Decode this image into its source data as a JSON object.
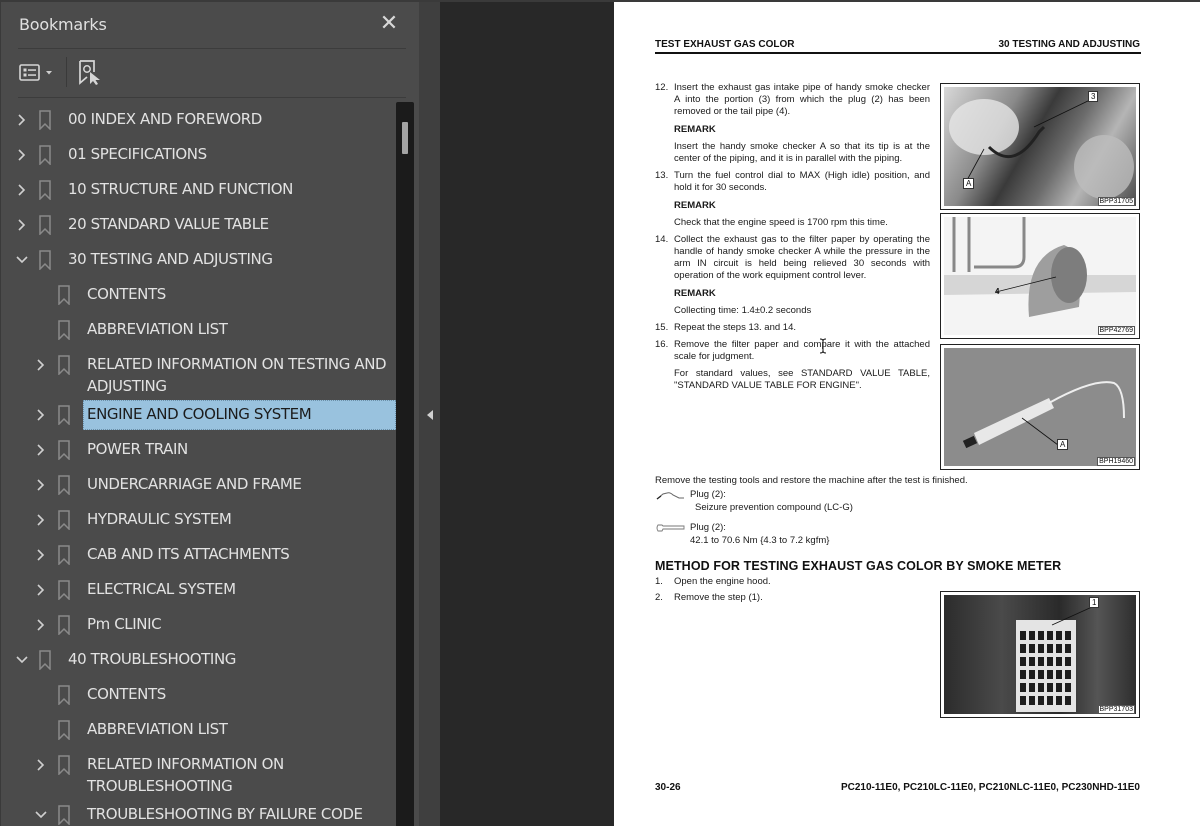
{
  "sidebar": {
    "title": "Bookmarks",
    "close_icon": "close-icon",
    "toolbar": {
      "options_icon": "bookmark-options-icon",
      "find_icon": "find-current-bookmark-icon"
    },
    "items": [
      {
        "label": "00 INDEX AND FOREWORD",
        "level": 0,
        "state": "collapsed"
      },
      {
        "label": "01 SPECIFICATIONS",
        "level": 0,
        "state": "collapsed"
      },
      {
        "label": "10 STRUCTURE AND FUNCTION",
        "level": 0,
        "state": "collapsed"
      },
      {
        "label": "20 STANDARD VALUE TABLE",
        "level": 0,
        "state": "collapsed"
      },
      {
        "label": "30 TESTING AND ADJUSTING",
        "level": 0,
        "state": "expanded"
      },
      {
        "label": "CONTENTS",
        "level": 1,
        "state": "leaf"
      },
      {
        "label": "ABBREVIATION LIST",
        "level": 1,
        "state": "leaf"
      },
      {
        "label": "RELATED INFORMATION ON TESTING AND ADJUSTING",
        "level": 1,
        "state": "collapsed"
      },
      {
        "label": "ENGINE AND COOLING SYSTEM",
        "level": 1,
        "state": "collapsed",
        "selected": true
      },
      {
        "label": "POWER TRAIN",
        "level": 1,
        "state": "collapsed"
      },
      {
        "label": "UNDERCARRIAGE AND FRAME",
        "level": 1,
        "state": "collapsed"
      },
      {
        "label": "HYDRAULIC SYSTEM",
        "level": 1,
        "state": "collapsed"
      },
      {
        "label": "CAB AND ITS ATTACHMENTS",
        "level": 1,
        "state": "collapsed"
      },
      {
        "label": "ELECTRICAL SYSTEM",
        "level": 1,
        "state": "collapsed"
      },
      {
        "label": "Pm CLINIC",
        "level": 1,
        "state": "collapsed"
      },
      {
        "label": "40 TROUBLESHOOTING",
        "level": 0,
        "state": "expanded"
      },
      {
        "label": "CONTENTS",
        "level": 1,
        "state": "leaf"
      },
      {
        "label": "ABBREVIATION LIST",
        "level": 1,
        "state": "leaf"
      },
      {
        "label": "RELATED INFORMATION ON TROUBLESHOOTING",
        "level": 1,
        "state": "collapsed"
      },
      {
        "label": "TROUBLESHOOTING BY FAILURE CODE",
        "level": 1,
        "state": "expanded"
      }
    ],
    "selection_color": "#99c2de"
  },
  "document": {
    "header_left": "TEST EXHAUST GAS COLOR",
    "header_right": "30 TESTING AND ADJUSTING",
    "steps": [
      {
        "num": "12.",
        "text": "Insert the exhaust gas intake pipe of handy smoke checker A into the portion (3) from which the plug (2) has been removed or the tail pipe (4).",
        "remark_label": "REMARK",
        "remark": "Insert the handy smoke checker A so that its tip is at the center of the piping, and it is in parallel with the piping."
      },
      {
        "num": "13.",
        "text": "Turn the fuel control dial to MAX (High idle) position, and hold it for 30 seconds.",
        "remark_label": "REMARK",
        "remark": "Check that the engine speed is 1700 rpm this time."
      },
      {
        "num": "14.",
        "text": "Collect the exhaust gas to the filter paper by operating the handle of handy smoke checker A while the pressure in the arm IN circuit is held being relieved 30 seconds with operation of the work equipment control lever.",
        "remark_label": "REMARK",
        "remark": "Collecting time: 1.4±0.2 seconds"
      },
      {
        "num": "15.",
        "text": "Repeat the steps 13. and 14."
      },
      {
        "num": "16.",
        "text": "Remove the filter paper and compare it with the attached scale for judgment.",
        "note": "For standard values, see STANDARD VALUE TABLE, \"STANDARD VALUE TABLE FOR ENGINE\"."
      }
    ],
    "figures": [
      {
        "code": "BPP31705",
        "callouts": [
          "3",
          "A"
        ]
      },
      {
        "code": "BPP42769",
        "callouts": [
          "4"
        ]
      },
      {
        "code": "BPH19460",
        "callouts": [
          "A"
        ]
      },
      {
        "code": "BPP31703",
        "callouts": [
          "1"
        ]
      }
    ],
    "restore_text": "Remove the testing tools and restore the machine after the test is finished.",
    "specs": [
      {
        "icon": "sealant-icon",
        "label": "Plug (2):",
        "value": "Seizure prevention compound (LC-G)"
      },
      {
        "icon": "torque-wrench-icon",
        "label": "Plug (2):",
        "value": "42.1 to 70.6 Nm {4.3 to 7.2 kgfm}"
      }
    ],
    "method_title": "METHOD FOR TESTING EXHAUST GAS COLOR BY SMOKE METER",
    "method_steps": [
      {
        "num": "1.",
        "text": "Open the engine hood."
      },
      {
        "num": "2.",
        "text": "Remove the step (1)."
      }
    ],
    "footer_left": "30-26",
    "footer_right": "PC210-11E0, PC210LC-11E0, PC210NLC-11E0, PC230NHD-11E0"
  }
}
